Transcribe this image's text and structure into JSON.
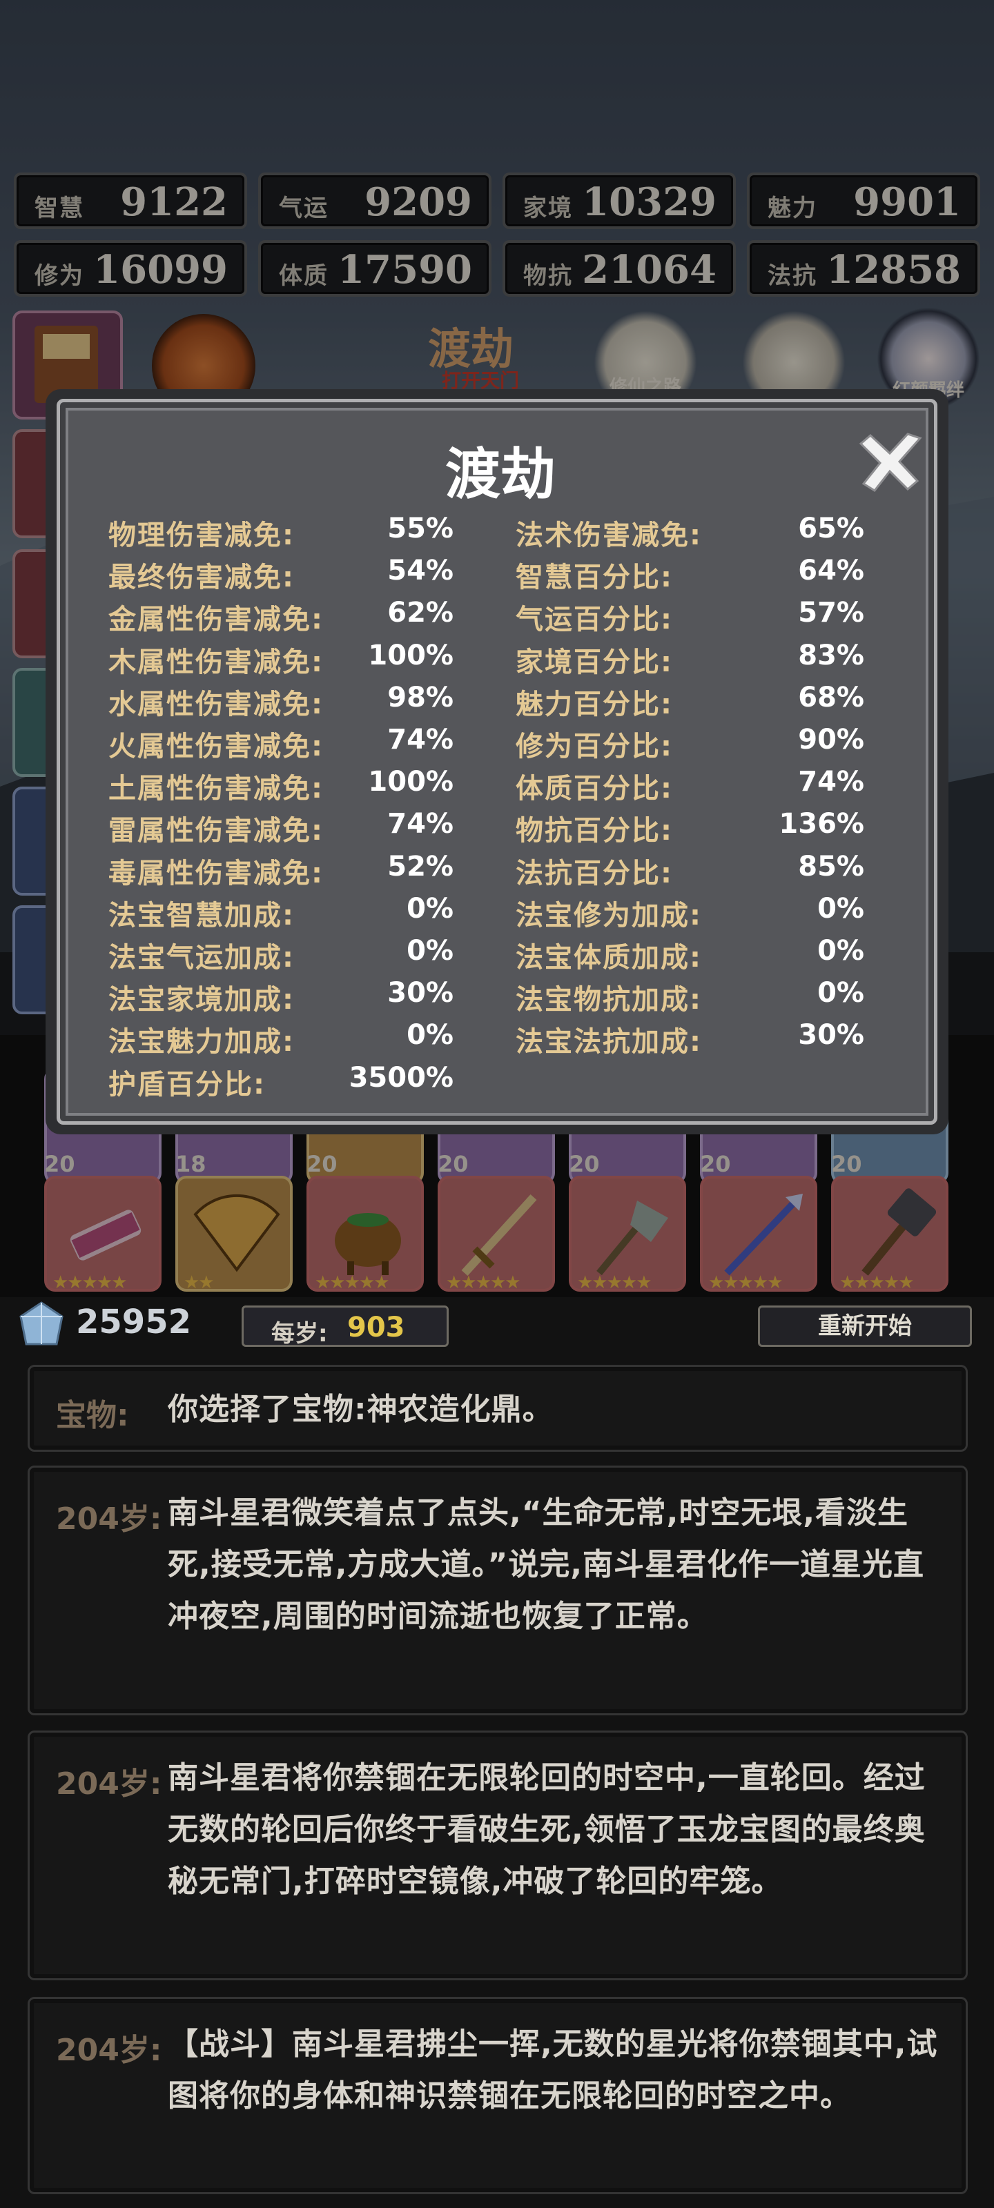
{
  "stats": [
    {
      "label": "智慧",
      "value": "9122"
    },
    {
      "label": "气运",
      "value": "9209"
    },
    {
      "label": "家境",
      "value": "10329"
    },
    {
      "label": "魅力",
      "value": "9901"
    },
    {
      "label": "修为",
      "value": "16099"
    },
    {
      "label": "体质",
      "value": "17590"
    },
    {
      "label": "物抗",
      "value": "21064"
    },
    {
      "label": "法抗",
      "value": "12858"
    }
  ],
  "menu": {
    "title": "渡劫",
    "subtitle": "打开天门",
    "icon_label_1": "修仙之路",
    "icon_label_2": "红颜羁绊"
  },
  "modal": {
    "title": "渡劫",
    "left": [
      {
        "label": "物理伤害减免:",
        "value": "55%"
      },
      {
        "label": "最终伤害减免:",
        "value": "54%"
      },
      {
        "label": "金属性伤害减免:",
        "value": "62%"
      },
      {
        "label": "木属性伤害减免:",
        "value": "100%"
      },
      {
        "label": "水属性伤害减免:",
        "value": "98%"
      },
      {
        "label": "火属性伤害减免:",
        "value": "74%"
      },
      {
        "label": "土属性伤害减免:",
        "value": "100%"
      },
      {
        "label": "雷属性伤害减免:",
        "value": "74%"
      },
      {
        "label": "毒属性伤害减免:",
        "value": "52%"
      },
      {
        "label": "法宝智慧加成:",
        "value": "0%"
      },
      {
        "label": "法宝气运加成:",
        "value": "0%"
      },
      {
        "label": "法宝家境加成:",
        "value": "30%"
      },
      {
        "label": "法宝魅力加成:",
        "value": "0%"
      },
      {
        "label": "护盾百分比:",
        "value": "3500%"
      }
    ],
    "right": [
      {
        "label": "法术伤害减免:",
        "value": "65%"
      },
      {
        "label": "智慧百分比:",
        "value": "64%"
      },
      {
        "label": "气运百分比:",
        "value": "57%"
      },
      {
        "label": "家境百分比:",
        "value": "83%"
      },
      {
        "label": "魅力百分比:",
        "value": "68%"
      },
      {
        "label": "修为百分比:",
        "value": "90%"
      },
      {
        "label": "体质百分比:",
        "value": "74%"
      },
      {
        "label": "物抗百分比:",
        "value": "136%"
      },
      {
        "label": "法抗百分比:",
        "value": "85%"
      },
      {
        "label": "法宝修为加成:",
        "value": "0%"
      },
      {
        "label": "法宝体质加成:",
        "value": "0%"
      },
      {
        "label": "法宝物抗加成:",
        "value": "0%"
      },
      {
        "label": "法宝法抗加成:",
        "value": "30%"
      }
    ]
  },
  "items_row2": [
    {
      "level": "20",
      "stars": "★★★★★",
      "icon": "scroll-icon"
    },
    {
      "level": "18",
      "stars": "★★",
      "icon": "fan-icon"
    },
    {
      "level": "20",
      "stars": "★★★★★",
      "icon": "cauldron-icon"
    },
    {
      "level": "20",
      "stars": "★★★★★",
      "icon": "sword-icon"
    },
    {
      "level": "20",
      "stars": "★★★★★",
      "icon": "axe-icon"
    },
    {
      "level": "20",
      "stars": "★★★★★",
      "icon": "spear-icon"
    },
    {
      "level": "20",
      "stars": "★★★★★",
      "icon": "hammer-icon"
    }
  ],
  "resources": {
    "gems": "25952",
    "age_label": "每岁:",
    "age_value": "903",
    "restart": "重新开始"
  },
  "log": [
    {
      "tag": "宝物:",
      "text": "你选择了宝物:神农造化鼎。"
    },
    {
      "tag": "204岁:",
      "text": "南斗星君微笑着点了点头,“生命无常,时空无垠,看淡生死,接受无常,方成大道。”说完,南斗星君化作一道星光直冲夜空,周围的时间流逝也恢复了正常。"
    },
    {
      "tag": "204岁:",
      "text": "南斗星君将你禁锢在无限轮回的时空中,一直轮回。经过无数的轮回后你终于看破生死,领悟了玉龙宝图的最终奥秘无常门,打碎时空镜像,冲破了轮回的牢笼。"
    },
    {
      "tag": "204岁:",
      "text": "【战斗】南斗星君拂尘一挥,无数的星光将你禁锢其中,试图将你的身体和神识禁锢在无限轮回的时空之中。"
    }
  ]
}
